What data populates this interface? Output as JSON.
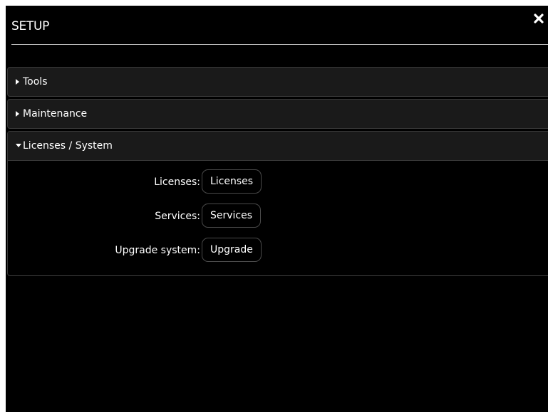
{
  "dialog": {
    "title": "SETUP",
    "close_icon": "close-icon"
  },
  "sections": [
    {
      "label": "Tools",
      "expanded": false
    },
    {
      "label": "Maintenance",
      "expanded": false
    },
    {
      "label": "Licenses / System",
      "expanded": true
    }
  ],
  "licenses_system": {
    "rows": [
      {
        "label": "Licenses:",
        "button": "Licenses"
      },
      {
        "label": "Services:",
        "button": "Services"
      },
      {
        "label": "Upgrade system:",
        "button": "Upgrade"
      }
    ]
  },
  "colors": {
    "background": "#000000",
    "panel": "#1a1a1a",
    "text": "#ffffff"
  }
}
